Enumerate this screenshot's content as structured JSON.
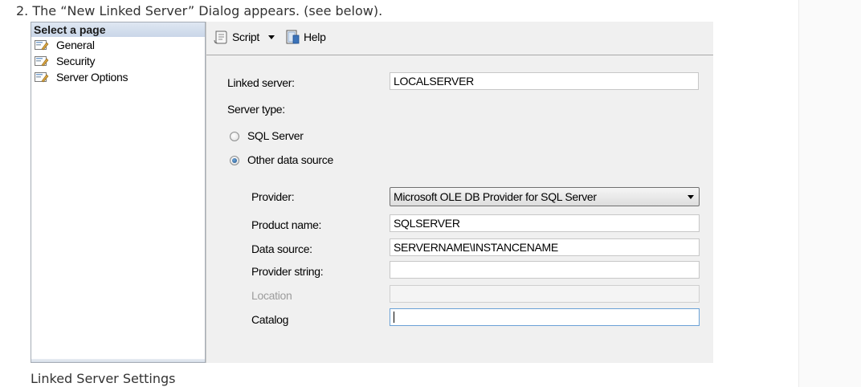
{
  "article": {
    "step_text": "2. The “New Linked Server” Dialog appears.  (see below).",
    "caption": "Linked Server Settings"
  },
  "sidebar": {
    "header": "Select a page",
    "items": [
      {
        "label": "General",
        "icon": "page-settings-icon"
      },
      {
        "label": "Security",
        "icon": "page-settings-icon"
      },
      {
        "label": "Server Options",
        "icon": "page-settings-icon"
      }
    ]
  },
  "toolbar": {
    "script_label": "Script",
    "help_label": "Help"
  },
  "form": {
    "linked_server": {
      "label": "Linked server:",
      "value": "LOCALSERVER"
    },
    "server_type_label": "Server type:",
    "server_type_options": [
      {
        "label": "SQL Server",
        "selected": false
      },
      {
        "label": "Other data source",
        "selected": true
      }
    ],
    "provider": {
      "label": "Provider:",
      "value": "Microsoft OLE DB Provider for SQL Server"
    },
    "product_name": {
      "label": "Product name:",
      "value": "SQLSERVER"
    },
    "data_source": {
      "label": "Data source:",
      "value": "SERVERNAME\\INSTANCENAME"
    },
    "provider_string": {
      "label": "Provider string:",
      "value": ""
    },
    "location": {
      "label": "Location",
      "value": "",
      "disabled": true
    },
    "catalog": {
      "label": "Catalog",
      "value": ""
    }
  },
  "colors": {
    "accent_focus": "#6aa1d6",
    "pane_background": "#f0f0f0"
  }
}
